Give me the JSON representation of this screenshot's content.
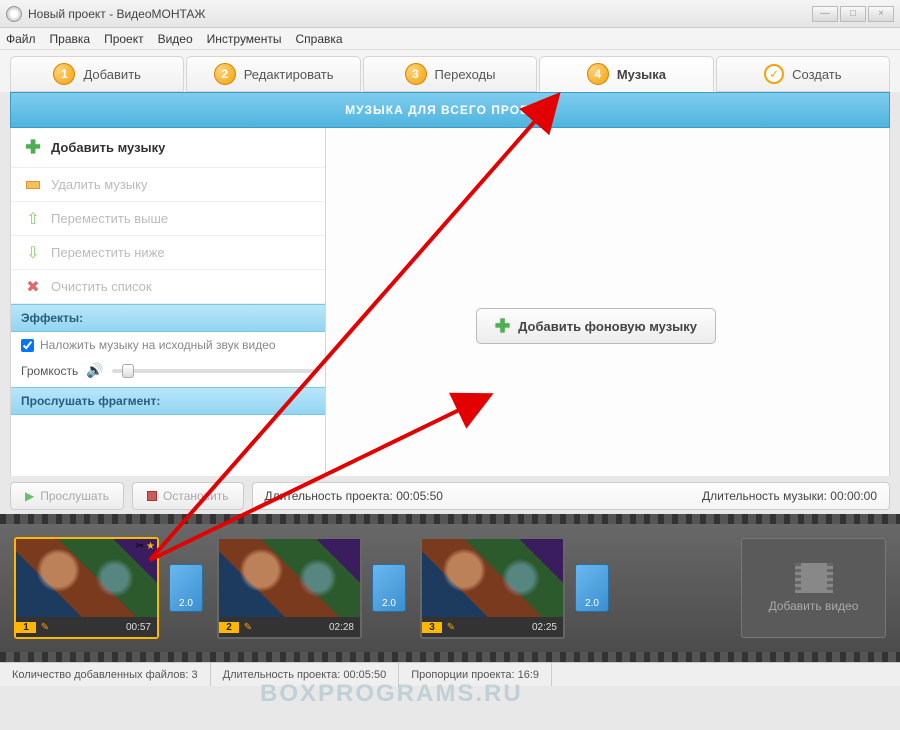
{
  "titlebar": {
    "title": "Новый проект - ВидеоМОНТАЖ"
  },
  "menu": [
    "Файл",
    "Правка",
    "Проект",
    "Видео",
    "Инструменты",
    "Справка"
  ],
  "wizard": [
    {
      "num": "1",
      "label": "Добавить"
    },
    {
      "num": "2",
      "label": "Редактировать"
    },
    {
      "num": "3",
      "label": "Переходы"
    },
    {
      "num": "4",
      "label": "Музыка",
      "active": true
    },
    {
      "num": "✓",
      "label": "Создать",
      "check": true
    }
  ],
  "blue_header": "МУЗЫКА ДЛЯ ВСЕГО ПРОЕКТА",
  "sidebar": {
    "add_music": "Добавить музыку",
    "delete_music": "Удалить музыку",
    "move_up": "Переместить выше",
    "move_down": "Переместить ниже",
    "clear_list": "Очистить список",
    "effects_head": "Эффекты:",
    "overlay_check": "Наложить музыку на исходный звук видео",
    "volume_label": "Громкость",
    "preview_head": "Прослушать фрагмент:"
  },
  "controls": {
    "play": "Прослушать",
    "stop": "Остановить",
    "proj_duration_label": "Длительность проекта:",
    "proj_duration": "00:05:50",
    "music_duration_label": "Длительность музыки:",
    "music_duration": "00:00:00"
  },
  "content": {
    "add_bg_music": "Добавить фоновую музыку"
  },
  "timeline": {
    "clips": [
      {
        "num": "1",
        "time": "00:57"
      },
      {
        "num": "2",
        "time": "02:28"
      },
      {
        "num": "3",
        "time": "02:25"
      }
    ],
    "transition": "2.0",
    "add_video": "Добавить видео"
  },
  "status": {
    "files_label": "Количество добавленных файлов:",
    "files": "3",
    "dur_label": "Длительность проекта:",
    "dur": "00:05:50",
    "ratio_label": "Пропорции проекта:",
    "ratio": "16:9"
  },
  "watermark": "BOXPROGRAMS.RU"
}
